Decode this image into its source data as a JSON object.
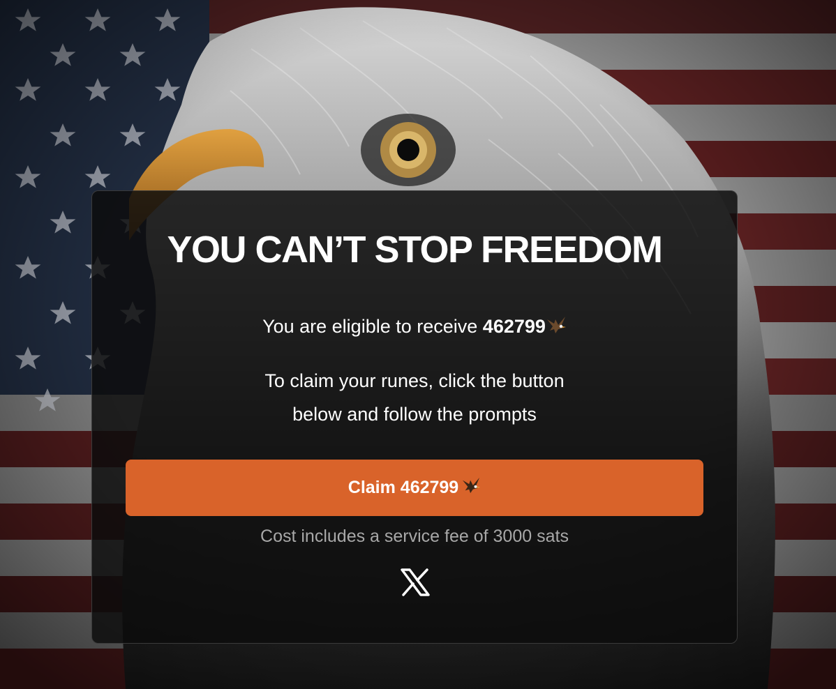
{
  "modal": {
    "title": "YOU CAN’T STOP FREEDOM",
    "eligible_prefix": "You are eligible to receive ",
    "eligible_amount": "462799",
    "instructions_line1": "To claim your runes, click the button",
    "instructions_line2": "below and follow the prompts",
    "claim_button_label": "Claim 462799",
    "fee_note": "Cost includes a service fee of 3000 sats",
    "social_icon": "x-logo-icon"
  },
  "colors": {
    "accent": "#d9632a",
    "modal_bg": "#0c0c0c",
    "muted_text": "#a8a8a8"
  }
}
